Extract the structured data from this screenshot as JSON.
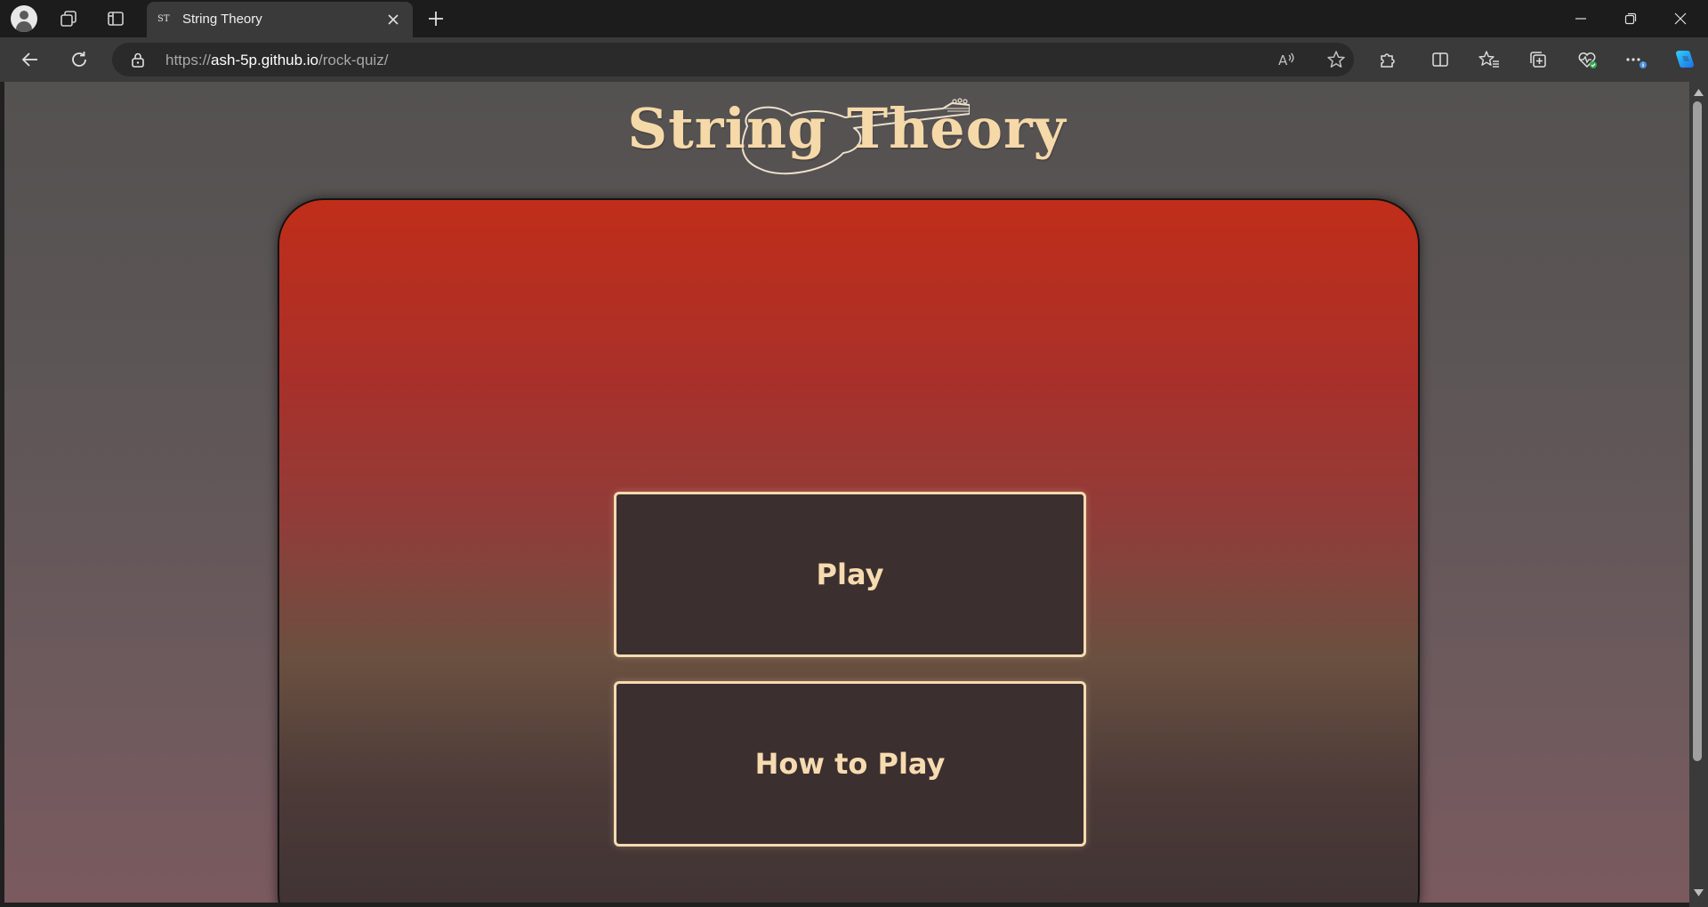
{
  "browser": {
    "tab_title": "String Theory",
    "tab_favicon_text": "ST",
    "url_prefix": "https://",
    "url_host": "ash-5p.github.io",
    "url_path": "/rock-quiz/"
  },
  "page": {
    "logo_text": "String Theory",
    "play_label": "Play",
    "how_to_play_label": "How to Play"
  },
  "colors": {
    "accent_cream": "#f6dbb0",
    "card_top": "#c02e19",
    "card_bottom": "#3d3233",
    "button_bg": "#3c2f2f"
  },
  "icons": {
    "profile": "profile-icon",
    "workspaces": "workspaces-icon",
    "vertical_tabs": "vertical-tabs-icon",
    "close_tab": "close-icon",
    "new_tab": "plus-icon",
    "back": "back-arrow-icon",
    "refresh": "refresh-icon",
    "lock": "lock-icon",
    "read_aloud": "read-aloud-icon",
    "favorite": "star-icon",
    "extensions": "extensions-icon",
    "split_screen": "split-screen-icon",
    "favorites": "favorites-icon",
    "collections": "collections-icon",
    "browser_essentials": "heart-pulse-icon",
    "more": "more-icon",
    "copilot": "copilot-icon"
  }
}
